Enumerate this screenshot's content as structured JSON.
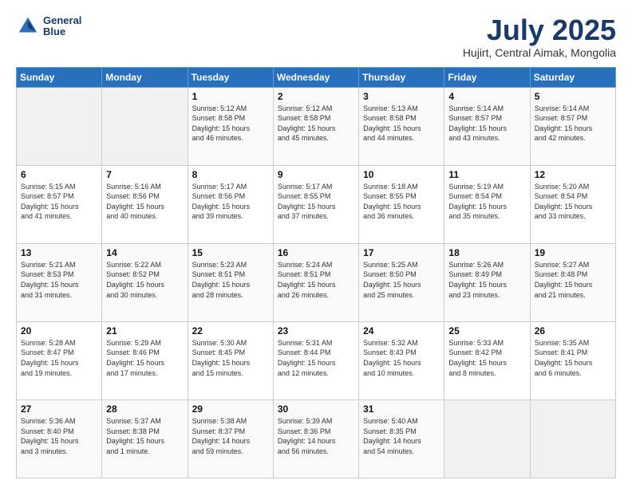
{
  "logo": {
    "line1": "General",
    "line2": "Blue"
  },
  "title": "July 2025",
  "subtitle": "Hujirt, Central Aimak, Mongolia",
  "header_days": [
    "Sunday",
    "Monday",
    "Tuesday",
    "Wednesday",
    "Thursday",
    "Friday",
    "Saturday"
  ],
  "weeks": [
    [
      {
        "day": "",
        "info": ""
      },
      {
        "day": "",
        "info": ""
      },
      {
        "day": "1",
        "info": "Sunrise: 5:12 AM\nSunset: 8:58 PM\nDaylight: 15 hours\nand 46 minutes."
      },
      {
        "day": "2",
        "info": "Sunrise: 5:12 AM\nSunset: 8:58 PM\nDaylight: 15 hours\nand 45 minutes."
      },
      {
        "day": "3",
        "info": "Sunrise: 5:13 AM\nSunset: 8:58 PM\nDaylight: 15 hours\nand 44 minutes."
      },
      {
        "day": "4",
        "info": "Sunrise: 5:14 AM\nSunset: 8:57 PM\nDaylight: 15 hours\nand 43 minutes."
      },
      {
        "day": "5",
        "info": "Sunrise: 5:14 AM\nSunset: 8:57 PM\nDaylight: 15 hours\nand 42 minutes."
      }
    ],
    [
      {
        "day": "6",
        "info": "Sunrise: 5:15 AM\nSunset: 8:57 PM\nDaylight: 15 hours\nand 41 minutes."
      },
      {
        "day": "7",
        "info": "Sunrise: 5:16 AM\nSunset: 8:56 PM\nDaylight: 15 hours\nand 40 minutes."
      },
      {
        "day": "8",
        "info": "Sunrise: 5:17 AM\nSunset: 8:56 PM\nDaylight: 15 hours\nand 39 minutes."
      },
      {
        "day": "9",
        "info": "Sunrise: 5:17 AM\nSunset: 8:55 PM\nDaylight: 15 hours\nand 37 minutes."
      },
      {
        "day": "10",
        "info": "Sunrise: 5:18 AM\nSunset: 8:55 PM\nDaylight: 15 hours\nand 36 minutes."
      },
      {
        "day": "11",
        "info": "Sunrise: 5:19 AM\nSunset: 8:54 PM\nDaylight: 15 hours\nand 35 minutes."
      },
      {
        "day": "12",
        "info": "Sunrise: 5:20 AM\nSunset: 8:54 PM\nDaylight: 15 hours\nand 33 minutes."
      }
    ],
    [
      {
        "day": "13",
        "info": "Sunrise: 5:21 AM\nSunset: 8:53 PM\nDaylight: 15 hours\nand 31 minutes."
      },
      {
        "day": "14",
        "info": "Sunrise: 5:22 AM\nSunset: 8:52 PM\nDaylight: 15 hours\nand 30 minutes."
      },
      {
        "day": "15",
        "info": "Sunrise: 5:23 AM\nSunset: 8:51 PM\nDaylight: 15 hours\nand 28 minutes."
      },
      {
        "day": "16",
        "info": "Sunrise: 5:24 AM\nSunset: 8:51 PM\nDaylight: 15 hours\nand 26 minutes."
      },
      {
        "day": "17",
        "info": "Sunrise: 5:25 AM\nSunset: 8:50 PM\nDaylight: 15 hours\nand 25 minutes."
      },
      {
        "day": "18",
        "info": "Sunrise: 5:26 AM\nSunset: 8:49 PM\nDaylight: 15 hours\nand 23 minutes."
      },
      {
        "day": "19",
        "info": "Sunrise: 5:27 AM\nSunset: 8:48 PM\nDaylight: 15 hours\nand 21 minutes."
      }
    ],
    [
      {
        "day": "20",
        "info": "Sunrise: 5:28 AM\nSunset: 8:47 PM\nDaylight: 15 hours\nand 19 minutes."
      },
      {
        "day": "21",
        "info": "Sunrise: 5:29 AM\nSunset: 8:46 PM\nDaylight: 15 hours\nand 17 minutes."
      },
      {
        "day": "22",
        "info": "Sunrise: 5:30 AM\nSunset: 8:45 PM\nDaylight: 15 hours\nand 15 minutes."
      },
      {
        "day": "23",
        "info": "Sunrise: 5:31 AM\nSunset: 8:44 PM\nDaylight: 15 hours\nand 12 minutes."
      },
      {
        "day": "24",
        "info": "Sunrise: 5:32 AM\nSunset: 8:43 PM\nDaylight: 15 hours\nand 10 minutes."
      },
      {
        "day": "25",
        "info": "Sunrise: 5:33 AM\nSunset: 8:42 PM\nDaylight: 15 hours\nand 8 minutes."
      },
      {
        "day": "26",
        "info": "Sunrise: 5:35 AM\nSunset: 8:41 PM\nDaylight: 15 hours\nand 6 minutes."
      }
    ],
    [
      {
        "day": "27",
        "info": "Sunrise: 5:36 AM\nSunset: 8:40 PM\nDaylight: 15 hours\nand 3 minutes."
      },
      {
        "day": "28",
        "info": "Sunrise: 5:37 AM\nSunset: 8:38 PM\nDaylight: 15 hours\nand 1 minute."
      },
      {
        "day": "29",
        "info": "Sunrise: 5:38 AM\nSunset: 8:37 PM\nDaylight: 14 hours\nand 59 minutes."
      },
      {
        "day": "30",
        "info": "Sunrise: 5:39 AM\nSunset: 8:36 PM\nDaylight: 14 hours\nand 56 minutes."
      },
      {
        "day": "31",
        "info": "Sunrise: 5:40 AM\nSunset: 8:35 PM\nDaylight: 14 hours\nand 54 minutes."
      },
      {
        "day": "",
        "info": ""
      },
      {
        "day": "",
        "info": ""
      }
    ]
  ]
}
